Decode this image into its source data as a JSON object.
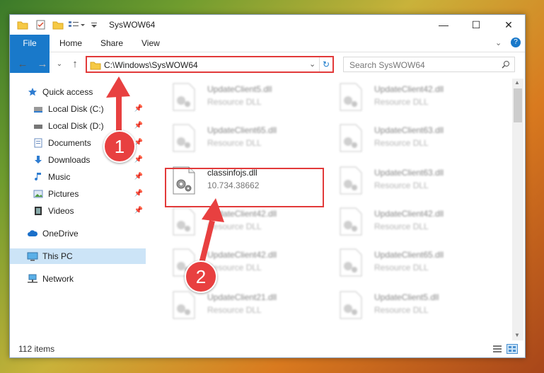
{
  "window": {
    "title": "SysWOW64",
    "minimize_glyph": "—",
    "maximize_glyph": "☐",
    "close_glyph": "✕"
  },
  "ribbon": {
    "file": "File",
    "home": "Home",
    "share": "Share",
    "view": "View"
  },
  "address": {
    "path": "C:\\Windows\\SysWOW64"
  },
  "search": {
    "placeholder": "Search SysWOW64"
  },
  "sidebar": {
    "items": [
      {
        "label": "Quick access",
        "icon": "star-icon"
      },
      {
        "label": "Local Disk (C:)",
        "icon": "drive-icon"
      },
      {
        "label": "Local Disk (D:)",
        "icon": "drive-icon"
      },
      {
        "label": "Documents",
        "icon": "documents-icon"
      },
      {
        "label": "Downloads",
        "icon": "downloads-icon"
      },
      {
        "label": "Music",
        "icon": "music-icon"
      },
      {
        "label": "Pictures",
        "icon": "pictures-icon"
      },
      {
        "label": "Videos",
        "icon": "videos-icon"
      },
      {
        "label": "OneDrive",
        "icon": "cloud-icon"
      },
      {
        "label": "This PC",
        "icon": "computer-icon"
      },
      {
        "label": "Network",
        "icon": "network-icon"
      }
    ]
  },
  "files": {
    "left": [
      {
        "name": "UpdateClient5.dll",
        "desc": "Resource DLL"
      },
      {
        "name": "UpdateClient65.dll",
        "desc": "Resource DLL"
      },
      {
        "name": "classinfojs.dll",
        "desc": "10.734.38662"
      },
      {
        "name": "UpdateClient42.dll",
        "desc": "Resource DLL"
      },
      {
        "name": "UpdateClient42.dll",
        "desc": "Resource DLL"
      },
      {
        "name": "UpdateClient21.dll",
        "desc": "Resource DLL"
      }
    ],
    "right": [
      {
        "name": "UpdateClient42.dll",
        "desc": "Resource DLL"
      },
      {
        "name": "UpdateClient63.dll",
        "desc": "Resource DLL"
      },
      {
        "name": "UpdateClient63.dll",
        "desc": "Resource DLL"
      },
      {
        "name": "UpdateClient42.dll",
        "desc": "Resource DLL"
      },
      {
        "name": "UpdateClient65.dll",
        "desc": "Resource DLL"
      },
      {
        "name": "UpdateClient5.dll",
        "desc": "Resource DLL"
      }
    ]
  },
  "status": {
    "count": "112 items"
  },
  "callouts": {
    "one": "1",
    "two": "2"
  },
  "colors": {
    "accent": "#1979ca",
    "highlight": "#e23a3a"
  }
}
